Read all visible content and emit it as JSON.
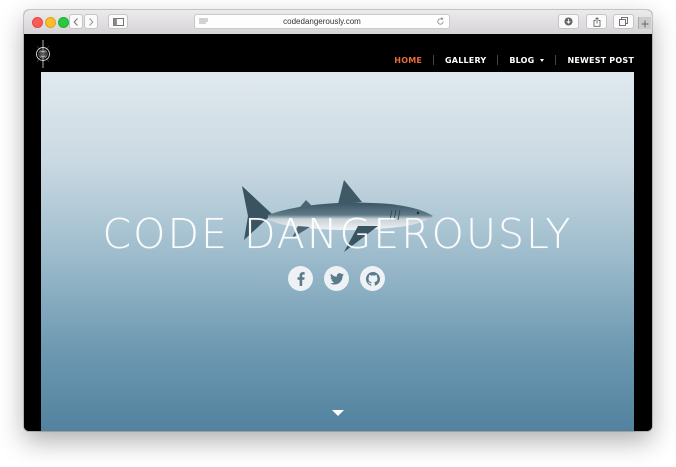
{
  "browser": {
    "url": "codedangerously.com",
    "traffic_lights": [
      "close",
      "minimize",
      "zoom"
    ],
    "icons": {
      "back": "chevron-left-icon",
      "forward": "chevron-right-icon",
      "sidebar": "sidebar-icon",
      "reader": "reader-lines-icon",
      "reload": "reload-icon",
      "downloads": "download-icon",
      "share": "share-icon",
      "tabs": "tabs-overview-icon",
      "new_tab": "plus-icon"
    }
  },
  "site": {
    "logo_icon": "compass-emblem-icon",
    "nav": {
      "items": [
        {
          "label": "HOME",
          "active": true
        },
        {
          "label": "GALLERY",
          "active": false
        },
        {
          "label": "BLOG",
          "active": false,
          "dropdown": true
        },
        {
          "label": "NEWEST POST",
          "active": false
        }
      ]
    },
    "hero": {
      "title": "CODE DANGEROUSLY",
      "image": "shark-photo",
      "socials": [
        {
          "name": "facebook",
          "icon": "facebook-icon"
        },
        {
          "name": "twitter",
          "icon": "twitter-icon"
        },
        {
          "name": "github",
          "icon": "github-icon"
        }
      ],
      "scroll_icon": "caret-down-icon"
    }
  },
  "colors": {
    "nav_active": "#e8693a",
    "nav_text": "#ffffff",
    "page_bg": "#000000",
    "hero_top": "#e0e9ef",
    "hero_bottom": "#52829e"
  }
}
